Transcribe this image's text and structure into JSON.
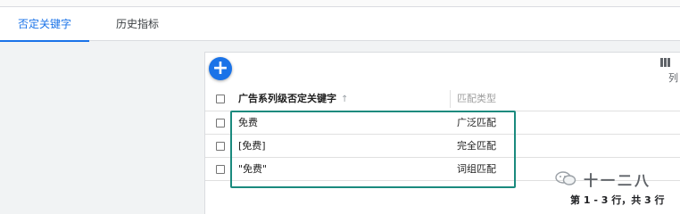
{
  "tabs": {
    "negative_keywords": "否定关键字",
    "history_metrics": "历史指标"
  },
  "toolbar": {
    "add_label": "+",
    "columns_label": "列",
    "columns_icon": "columns-icon"
  },
  "table": {
    "headers": {
      "keyword": "广告系列级否定关键字",
      "sort_indicator": "↑",
      "match_type": "匹配类型"
    },
    "rows": [
      {
        "keyword": "免费",
        "match_type": "广泛匹配"
      },
      {
        "keyword": "[免费]",
        "match_type": "完全匹配"
      },
      {
        "keyword": "\"免费\"",
        "match_type": "词组匹配"
      }
    ]
  },
  "pagination": {
    "summary": "第 1 - 3 行，共 3 行"
  },
  "watermark": {
    "icon": "wechat-icon",
    "text": "十一二八"
  },
  "colors": {
    "accent": "#1a73e8",
    "highlight_border": "#1a8a7e"
  }
}
